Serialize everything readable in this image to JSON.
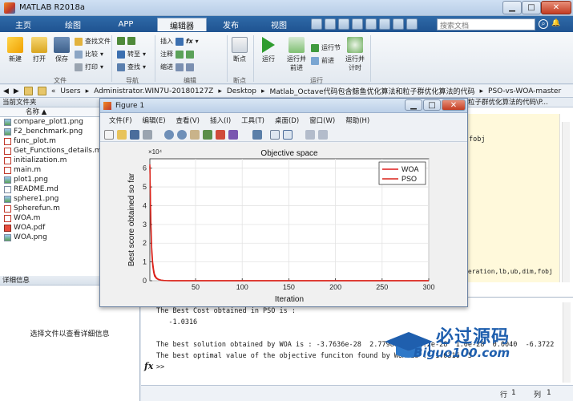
{
  "window": {
    "title": "MATLAB R2018a"
  },
  "search": {
    "placeholder": "搜索文档"
  },
  "tabs": [
    "主页",
    "绘图",
    "APP",
    "编辑器",
    "发布",
    "视图"
  ],
  "ribbon": {
    "new": "新建",
    "open": "打开",
    "save": "保存",
    "find_files": "查找文件",
    "compare": "比较",
    "print": "打印",
    "go_to": "转至",
    "find": "查找",
    "insert": "插入",
    "comment": "注释",
    "indent": "缩进",
    "fx": "fx",
    "breakpoints": "断点",
    "run": "运行",
    "run_and_advance": "运行并前进",
    "run_section": "运行节",
    "advance": "前进",
    "run_and_time": "运行并计时",
    "groups": {
      "file": "文件",
      "navigate": "导航",
      "edit": "编辑",
      "breakpoints": "断点",
      "run": "运行"
    }
  },
  "address": {
    "parts": [
      "«",
      "Users",
      "Administrator.WIN7U-20180127Z",
      "Desktop",
      "Matlab_Octave代码包含鲸鱼优化算法和粒子群优化算法的代码",
      "PSO-vs-WOA-master"
    ]
  },
  "current_folder": {
    "header": "当前文件夹",
    "column": "名称 ▲",
    "files": [
      {
        "name": "compare_plot1.png",
        "type": "png"
      },
      {
        "name": "F2_benchmark.png",
        "type": "png"
      },
      {
        "name": "func_plot.m",
        "type": "m"
      },
      {
        "name": "Get_Functions_details.m",
        "type": "m"
      },
      {
        "name": "initialization.m",
        "type": "m"
      },
      {
        "name": "main.m",
        "type": "m"
      },
      {
        "name": "plot1.png",
        "type": "png"
      },
      {
        "name": "README.md",
        "type": "md"
      },
      {
        "name": "sphere1.png",
        "type": "png"
      },
      {
        "name": "Spherefun.m",
        "type": "m"
      },
      {
        "name": "WOA.m",
        "type": "m"
      },
      {
        "name": "WOA.pdf",
        "type": "pdf"
      },
      {
        "name": "WOA.png",
        "type": "png"
      }
    ]
  },
  "details": {
    "header": "详细信息",
    "message": "选择文件以查看详细信息"
  },
  "editor": {
    "tab": "粒子群优化算法的代码\\P...",
    "line1": "fobj",
    "line2": "teration,lb,ub,dim,fobj"
  },
  "command_window": {
    "lines": [
      "The Best Cost obtained in PSO is :",
      "   -1.0316",
      "",
      "The best solution obtained by WOA is : -3.7636e-28  2.7798e-29  1.2e-28  1.0e-28  0.0040  -6.3722",
      "The best optimal value of the objective funciton found by WOA is : -1.0316 -5"
    ],
    "prompt": ">>",
    "fx": "fx"
  },
  "status": {
    "row_label": "行",
    "row": "1",
    "col_label": "列",
    "col": "1"
  },
  "figure": {
    "title": "Figure 1",
    "menu": [
      "文件(F)",
      "编辑(E)",
      "查看(V)",
      "插入(I)",
      "工具(T)",
      "桌面(D)",
      "窗口(W)",
      "帮助(H)"
    ]
  },
  "watermark": {
    "main": "必过源码",
    "sub": "Biguo100.com"
  },
  "colors": {
    "woa": "#e11b1b",
    "pso": "#d9241a",
    "tabbar": "#1f5391"
  },
  "chart_data": {
    "type": "line",
    "title": "Objective space",
    "xlabel": "Iteration",
    "ylabel": "Best score obtained so far",
    "y_exponent": "×10⁴",
    "xlim": [
      1,
      300
    ],
    "ylim": [
      0,
      65000
    ],
    "xticks": [
      50,
      100,
      150,
      200,
      250,
      300
    ],
    "yticks": [
      0,
      1,
      2,
      3,
      4,
      5,
      6
    ],
    "ytick_labels": [
      "0",
      "1",
      "2",
      "3",
      "4",
      "5",
      "6"
    ],
    "grid": true,
    "legend_position": "top-right",
    "series": [
      {
        "name": "WOA",
        "x": [
          1,
          2,
          3,
          4,
          5,
          6,
          8,
          10,
          13,
          16,
          20,
          25,
          30,
          40,
          300
        ],
        "y": [
          62000,
          30000,
          15000,
          8000,
          4500,
          2500,
          1200,
          600,
          250,
          100,
          40,
          12,
          3,
          0,
          0
        ]
      },
      {
        "name": "PSO",
        "x": [
          1,
          2,
          3,
          4,
          5,
          6,
          8,
          10,
          13,
          16,
          20,
          25,
          30,
          40,
          300
        ],
        "y": [
          61000,
          33000,
          18000,
          10000,
          6000,
          3500,
          1600,
          800,
          350,
          150,
          60,
          20,
          5,
          1,
          0
        ]
      }
    ]
  }
}
